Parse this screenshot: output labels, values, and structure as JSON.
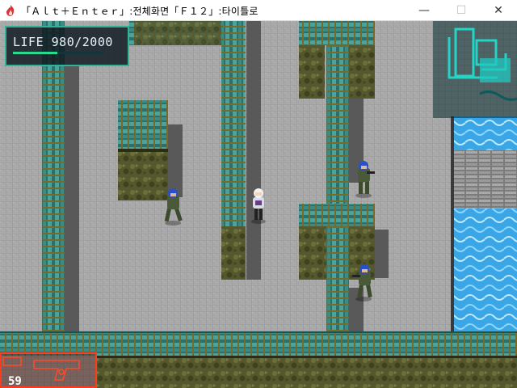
{
  "window": {
    "title": "「Ａｌｔ＋Ｅｎｔｅｒ」:전체화면「Ｆ１２」:타이틀로",
    "app_icon": "flame-icon",
    "minimize_glyph": "—",
    "maximize_glyph": "☐",
    "close_glyph": "✕"
  },
  "hud": {
    "life_text": "LIFE 980/2000",
    "life_current": 980,
    "life_max": 2000,
    "life_fraction": 0.49,
    "weapon_icon": "handgun-icon",
    "weapon_ammo": "59"
  },
  "minimap": {
    "icon": "facility-map-icon",
    "color": "#20c8c0"
  },
  "colors": {
    "floor": "#a8a8a8",
    "floor_grid": "#9a9a9a",
    "shadow": "#585858",
    "pipe": "#3a8c86",
    "pipe_dark": "#1e5450",
    "wall_top": "#6a6b30",
    "wall_face": "#4e5228",
    "water": "#4ab8ec",
    "grate": "#8a8a8a",
    "hud_border": "#2fb394",
    "weapon_border": "#ff3b1f",
    "soldier_uniform": "#4a5a38",
    "soldier_helmet": "#2a50c8"
  },
  "characters": [
    {
      "name": "player",
      "kind": "heroine"
    },
    {
      "name": "guard-1",
      "kind": "soldier"
    },
    {
      "name": "guard-2",
      "kind": "soldier"
    },
    {
      "name": "guard-3",
      "kind": "soldier"
    }
  ]
}
